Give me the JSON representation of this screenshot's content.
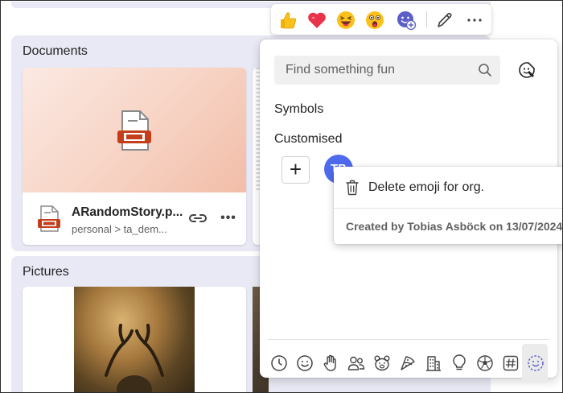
{
  "documents": {
    "title": "Documents",
    "card": {
      "file_name": "ARandomStory.p...",
      "path": "personal > ta_dem..."
    }
  },
  "pictures": {
    "title": "Pictures"
  },
  "reactions": {
    "items": [
      "thumbs-up",
      "heart",
      "laughing",
      "surprised",
      "more-emoji"
    ],
    "edit_icon": "pencil-icon",
    "more_icon": "ellipsis-icon"
  },
  "emoji_panel": {
    "search_placeholder": "Find something fun",
    "symbols_label": "Symbols",
    "customised_label": "Customised",
    "avatar_initials": "TB",
    "categories": [
      "recent",
      "smileys",
      "hand",
      "people",
      "animals",
      "food",
      "buildings",
      "objects",
      "activities",
      "symbols",
      "custom"
    ]
  },
  "context_menu": {
    "delete_label": "Delete emoji for org.",
    "created_by": "Created by Tobias Asböck on 13/07/2024"
  },
  "colors": {
    "section_bg": "#e8e9f4",
    "accent": "#4f6bed",
    "powerpoint": "#c43e1c"
  }
}
